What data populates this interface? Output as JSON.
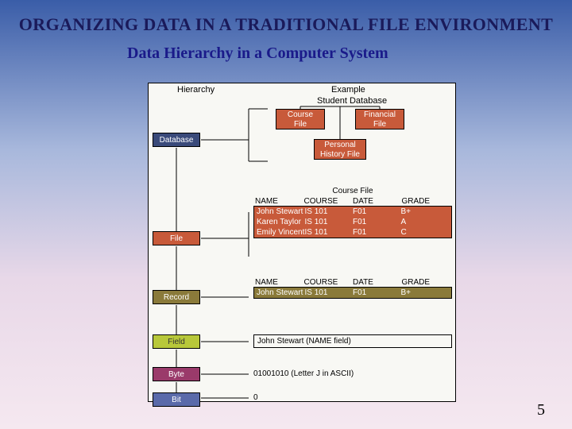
{
  "title": "ORGANIZING DATA IN A TRADITIONAL FILE ENVIRONMENT",
  "subtitle": "Data Hierarchy in a Computer System",
  "page_number": "5",
  "figure": {
    "hierarchy_heading": "Hierarchy",
    "example_heading": "Example",
    "example_subheading": "Student Database",
    "hierarchy": {
      "database": "Database",
      "file": "File",
      "record": "Record",
      "field": "Field",
      "byte": "Byte",
      "bit": "Bit"
    },
    "example_files": {
      "course_l1": "Course",
      "course_l2": "File",
      "financial_l1": "Financial",
      "financial_l2": "File",
      "personal_l1": "Personal",
      "personal_l2": "History File"
    },
    "course_table": {
      "caption": "Course File",
      "headers": {
        "name": "NAME",
        "course": "COURSE",
        "date": "DATE",
        "grade": "GRADE"
      },
      "rows": [
        {
          "name": "John Stewart",
          "course": "IS 101",
          "date": "F01",
          "grade": "B+"
        },
        {
          "name": "Karen Taylor",
          "course": "IS 101",
          "date": "F01",
          "grade": "A"
        },
        {
          "name": "Emily Vincent",
          "course": "IS 101",
          "date": "F01",
          "grade": "C"
        }
      ]
    },
    "record_table": {
      "headers": {
        "name": "NAME",
        "course": "COURSE",
        "date": "DATE",
        "grade": "GRADE"
      },
      "rows": [
        {
          "name": "John Stewart",
          "course": "IS 101",
          "date": "F01",
          "grade": "B+"
        }
      ]
    },
    "field_example": "John Stewart (NAME field)",
    "byte_example": "01001010  (Letter J in ASCII)",
    "bit_example": "0"
  }
}
